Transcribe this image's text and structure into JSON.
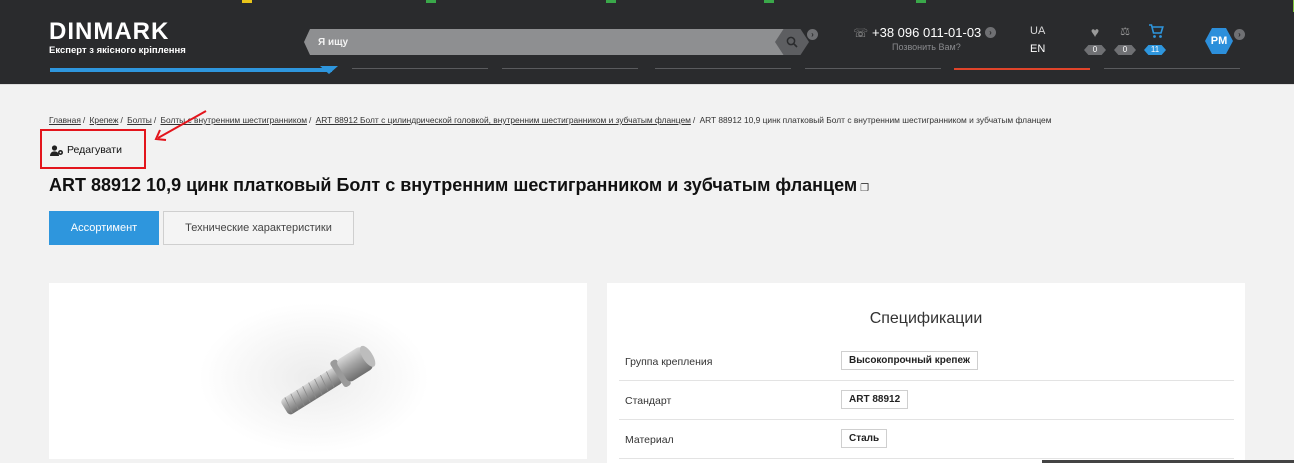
{
  "colors": {
    "header_bg": "#2a2b2d",
    "accent_blue": "#2e96dd",
    "nav_red": "#e0442a",
    "annotation_red": "#e3151c",
    "top_strip_green": "#7cc23a"
  },
  "header": {
    "logo_name": "DINMARK",
    "logo_tagline": "Експерт з якісного кріплення",
    "search_placeholder": "Я ищу",
    "search_icon": "search-icon",
    "phone": "+38 096 011-01-03",
    "phone_icon": "phone-icon",
    "callback": "Позвонить Вам?",
    "lang_ua": "UA",
    "lang_en": "EN",
    "favorites_count": "0",
    "compare_count": "0",
    "cart_count": "11",
    "avatar_initials": "PM"
  },
  "breadcrumb": {
    "items": [
      "Главная",
      "Крепеж",
      "Болты",
      "Болты с внутренним шестигранником",
      "ART 88912 Болт с цилиндрической головкой, внутренним шестигранником и зубчатым фланцем"
    ],
    "current": "ART 88912 10,9 цинк платковый Болт с внутренним шестигранником и зубчатым фланцем",
    "separator": "/"
  },
  "edit": {
    "label": "Редагувати",
    "icon": "user-gear-icon"
  },
  "product": {
    "title": "ART 88912 10,9 цинк платковый Болт с внутренним шестигранником и зубчатым фланцем",
    "copy_icon": "copy-icon"
  },
  "tabs": [
    {
      "label": "Ассортимент",
      "active": true
    },
    {
      "label": "Технические характеристики",
      "active": false
    }
  ],
  "specs": {
    "title": "Спецификации",
    "rows": [
      {
        "label": "Группа крепления",
        "value": "Высокопрочный крепеж"
      },
      {
        "label": "Стандарт",
        "value": "ART 88912"
      },
      {
        "label": "Материал",
        "value": "Сталь"
      }
    ]
  }
}
